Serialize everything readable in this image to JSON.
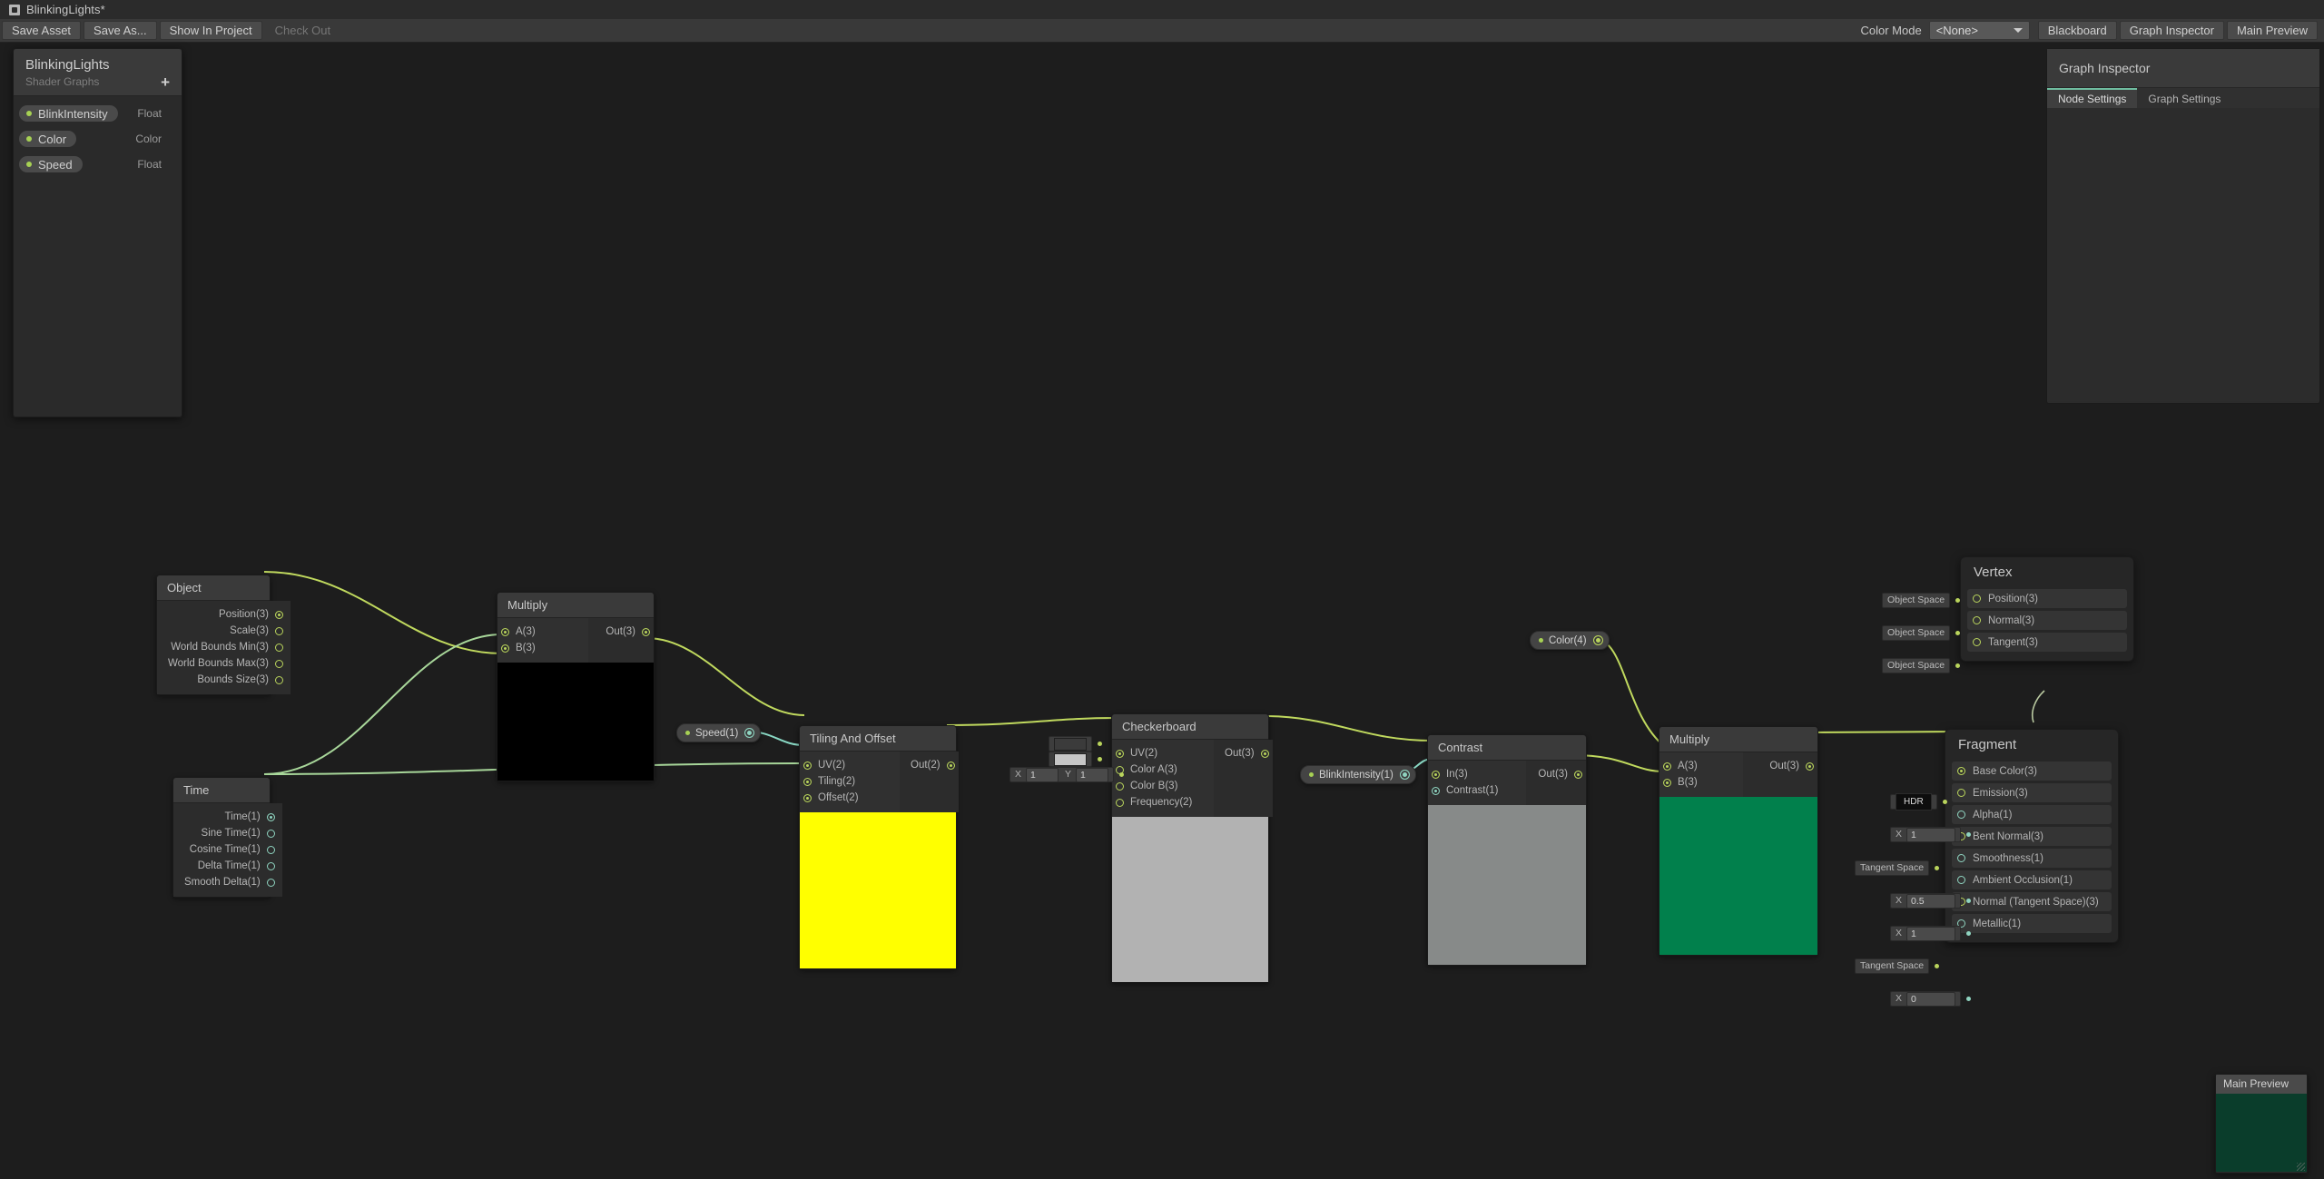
{
  "window": {
    "title": "BlinkingLights*",
    "icon": "shader-graph-icon"
  },
  "toolbar": {
    "save_asset": "Save Asset",
    "save_as": "Save As...",
    "show_in_project": "Show In Project",
    "check_out": "Check Out",
    "color_mode_label": "Color Mode",
    "color_mode_value": "<None>",
    "blackboard": "Blackboard",
    "graph_inspector": "Graph Inspector",
    "main_preview": "Main Preview"
  },
  "blackboard": {
    "title": "BlinkingLights",
    "subtitle": "Shader Graphs",
    "add_label": "+",
    "properties": [
      {
        "name": "BlinkIntensity",
        "type": "Float"
      },
      {
        "name": "Color",
        "type": "Color"
      },
      {
        "name": "Speed",
        "type": "Float"
      }
    ]
  },
  "inspector": {
    "title": "Graph Inspector",
    "tabs": [
      {
        "label": "Node Settings",
        "active": true
      },
      {
        "label": "Graph Settings",
        "active": false
      }
    ]
  },
  "main_preview": {
    "title": "Main Preview",
    "body_color": "#0a3d2b"
  },
  "colors": {
    "vector_wire": "#c0d95e",
    "float_wire": "#89d8c4",
    "accent_green": "#a7d154",
    "node_header": "#3a3a3a",
    "node_body": "#2c2c2c"
  },
  "nodes": [
    {
      "id": "object",
      "title": "Object",
      "inputs": [],
      "outputs": [
        {
          "label": "Position(3)",
          "connected": true,
          "kind": "vec"
        },
        {
          "label": "Scale(3)",
          "connected": false,
          "kind": "vec"
        },
        {
          "label": "World Bounds Min(3)",
          "connected": false,
          "kind": "vec"
        },
        {
          "label": "World Bounds Max(3)",
          "connected": false,
          "kind": "vec"
        },
        {
          "label": "Bounds Size(3)",
          "connected": false,
          "kind": "vec"
        }
      ]
    },
    {
      "id": "time",
      "title": "Time",
      "inputs": [],
      "outputs": [
        {
          "label": "Time(1)",
          "connected": true,
          "kind": "float"
        },
        {
          "label": "Sine Time(1)",
          "connected": false,
          "kind": "float"
        },
        {
          "label": "Cosine Time(1)",
          "connected": false,
          "kind": "float"
        },
        {
          "label": "Delta Time(1)",
          "connected": false,
          "kind": "float"
        },
        {
          "label": "Smooth Delta(1)",
          "connected": false,
          "kind": "float"
        }
      ]
    },
    {
      "id": "multiply1",
      "title": "Multiply",
      "inputs": [
        {
          "label": "A(3)",
          "connected": true,
          "kind": "vec"
        },
        {
          "label": "B(3)",
          "connected": true,
          "kind": "vec"
        }
      ],
      "outputs": [
        {
          "label": "Out(3)",
          "connected": true,
          "kind": "vec"
        }
      ],
      "preview_color": "#000000"
    },
    {
      "id": "tiling_and_offset",
      "title": "Tiling And Offset",
      "inputs": [
        {
          "label": "UV(2)",
          "connected": true,
          "kind": "vec"
        },
        {
          "label": "Tiling(2)",
          "connected": true,
          "kind": "vec"
        },
        {
          "label": "Offset(2)",
          "connected": true,
          "kind": "vec"
        }
      ],
      "outputs": [
        {
          "label": "Out(2)",
          "connected": true,
          "kind": "vec"
        }
      ],
      "preview_color": "#ffff00"
    },
    {
      "id": "checkerboard",
      "title": "Checkerboard",
      "inputs": [
        {
          "label": "UV(2)",
          "connected": true,
          "kind": "vec"
        },
        {
          "label": "Color A(3)",
          "connected": false,
          "kind": "vec",
          "widget": "swatch",
          "swatch_color": "#3b3b3b"
        },
        {
          "label": "Color B(3)",
          "connected": false,
          "kind": "vec",
          "widget": "swatch",
          "swatch_color": "#c6c6c6"
        },
        {
          "label": "Frequency(2)",
          "connected": false,
          "kind": "vec",
          "widget": "xy",
          "x": "1",
          "y": "1"
        }
      ],
      "outputs": [
        {
          "label": "Out(3)",
          "connected": true,
          "kind": "vec"
        }
      ],
      "preview_color": "#b2b2b2"
    },
    {
      "id": "contrast",
      "title": "Contrast",
      "inputs": [
        {
          "label": "In(3)",
          "connected": true,
          "kind": "vec"
        },
        {
          "label": "Contrast(1)",
          "connected": true,
          "kind": "float"
        }
      ],
      "outputs": [
        {
          "label": "Out(3)",
          "connected": true,
          "kind": "vec"
        }
      ],
      "preview_color": "#878a89"
    },
    {
      "id": "multiply2",
      "title": "Multiply",
      "inputs": [
        {
          "label": "A(3)",
          "connected": true,
          "kind": "vec"
        },
        {
          "label": "B(3)",
          "connected": true,
          "kind": "vec"
        }
      ],
      "outputs": [
        {
          "label": "Out(3)",
          "connected": true,
          "kind": "vec"
        }
      ],
      "preview_color": "#01804c"
    }
  ],
  "tokens": [
    {
      "id": "speed",
      "label": "Speed(1)",
      "kind": "float"
    },
    {
      "id": "blinkintensity",
      "label": "BlinkIntensity(1)",
      "kind": "float"
    },
    {
      "id": "color",
      "label": "Color(4)",
      "kind": "vec"
    }
  ],
  "vertex": {
    "title": "Vertex",
    "blocks": [
      {
        "label": "Position(3)",
        "widget": "text",
        "value": "Object Space",
        "kind": "vec"
      },
      {
        "label": "Normal(3)",
        "widget": "text",
        "value": "Object Space",
        "kind": "vec"
      },
      {
        "label": "Tangent(3)",
        "widget": "text",
        "value": "Object Space",
        "kind": "vec"
      }
    ]
  },
  "fragment": {
    "title": "Fragment",
    "blocks": [
      {
        "label": "Base Color(3)",
        "widget": "none",
        "value": "",
        "kind": "vec",
        "connected": true
      },
      {
        "label": "Emission(3)",
        "widget": "hdr",
        "value": "HDR",
        "kind": "vec"
      },
      {
        "label": "Alpha(1)",
        "widget": "x",
        "value": "1",
        "kind": "float"
      },
      {
        "label": "Bent Normal(3)",
        "widget": "text",
        "value": "Tangent Space",
        "kind": "vec"
      },
      {
        "label": "Smoothness(1)",
        "widget": "x",
        "value": "0.5",
        "kind": "float"
      },
      {
        "label": "Ambient Occlusion(1)",
        "widget": "x",
        "value": "1",
        "kind": "float"
      },
      {
        "label": "Normal (Tangent Space)(3)",
        "widget": "text",
        "value": "Tangent Space",
        "kind": "vec"
      },
      {
        "label": "Metallic(1)",
        "widget": "x",
        "value": "0",
        "kind": "float"
      }
    ]
  }
}
